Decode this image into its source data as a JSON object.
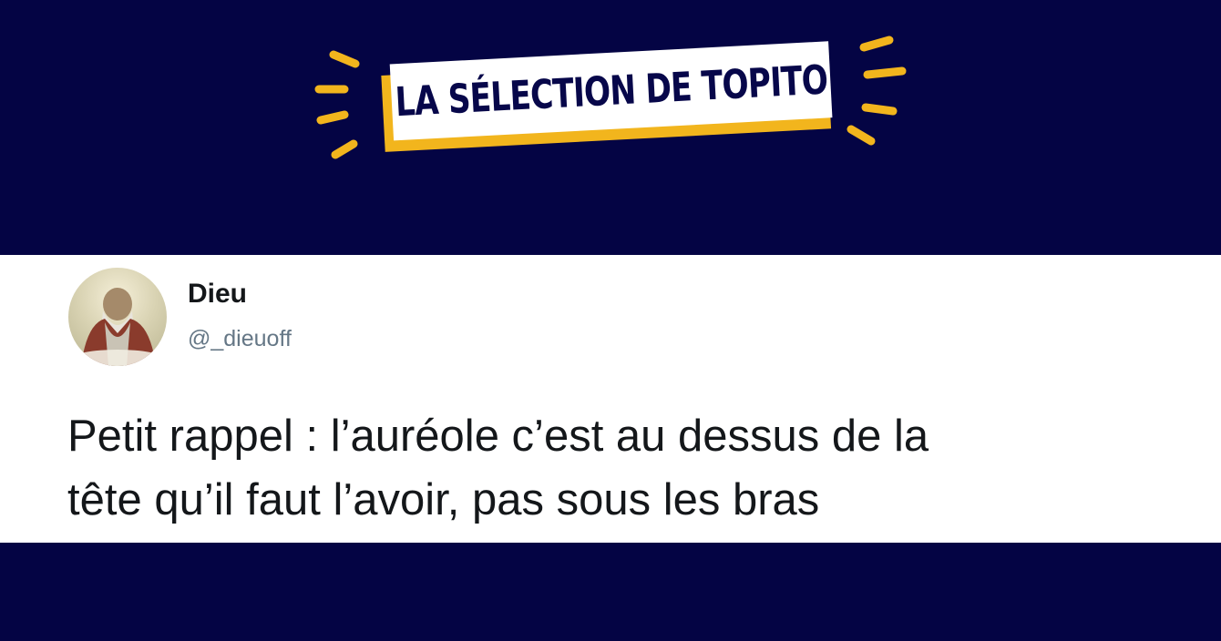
{
  "banner": {
    "title": "LA SÉLECTION DE TOPITO",
    "accent_color": "#f2b51d",
    "background_color": "#040444"
  },
  "tweet": {
    "author_name": "Dieu",
    "author_handle": "@_dieuoff",
    "text_lines": [
      "Petit rappel : l’auréole c’est au dessus de la",
      "tête qu’il faut l’avoir, pas sous les bras"
    ]
  }
}
